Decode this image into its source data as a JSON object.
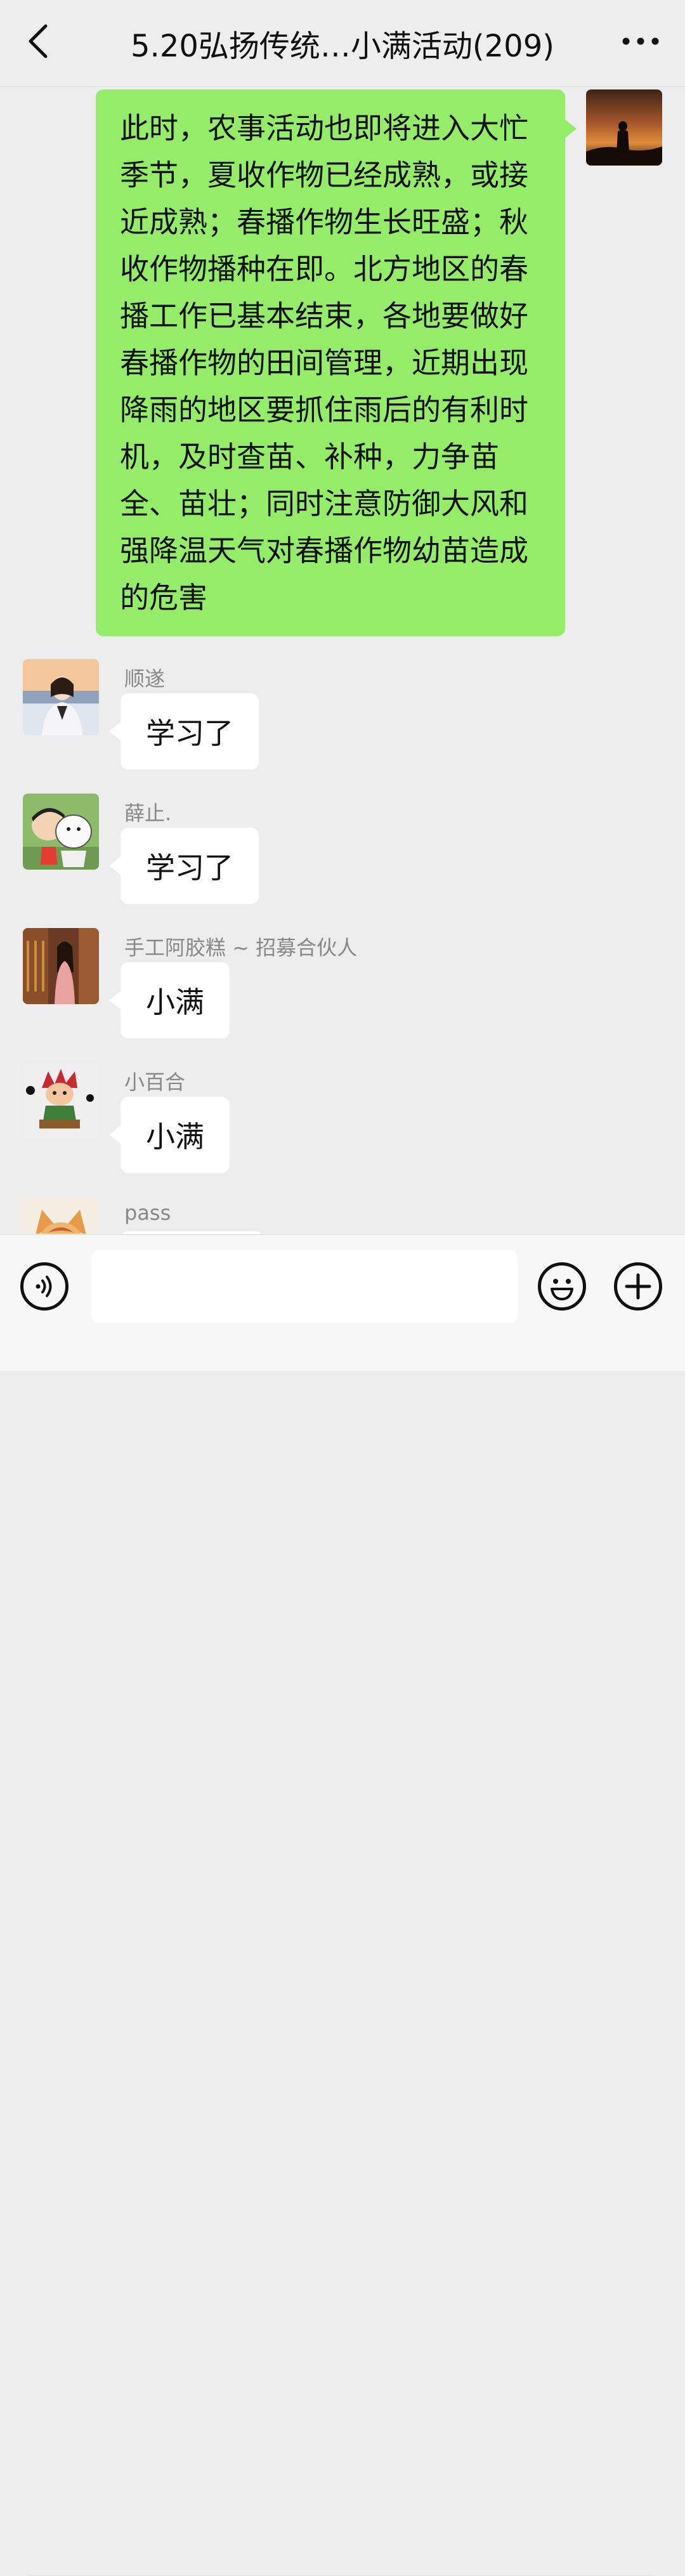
{
  "header": {
    "title": "5.20弘扬传统…小满活动(209)"
  },
  "messages": [
    {
      "sender": "",
      "self": true,
      "text": "此时，农事活动也即将进入大忙季节，夏收作物已经成熟，或接近成熟；春播作物生长旺盛；秋收作物播种在即。北方地区的春播工作已基本结束，各地要做好春播作物的田间管理，近期出现降雨的地区要抓住雨后的有利时机，及时查苗、补种，力争苗全、苗壮；同时注意防御大风和强降温天气对春播作物幼苗造成的危害"
    },
    {
      "sender": "顺遂",
      "self": false,
      "text": "学习了"
    },
    {
      "sender": "薛止.",
      "self": false,
      "text": "学习了"
    },
    {
      "sender": "手工阿胶糕 ~ 招募合伙人",
      "self": false,
      "text": "小满"
    },
    {
      "sender": "小百合",
      "self": false,
      "text": "小满"
    },
    {
      "sender": "pass",
      "self": false,
      "text": ""
    }
  ],
  "input": {
    "placeholder": ""
  },
  "colors": {
    "background": "#ededed",
    "self_bubble": "#95ec69",
    "other_bubble": "#ffffff",
    "name_text": "#888888"
  },
  "icons": {
    "back": "chevron-left-icon",
    "more": "more-dots-icon",
    "voice": "voice-icon",
    "emoji": "emoji-icon",
    "plus": "plus-icon"
  }
}
